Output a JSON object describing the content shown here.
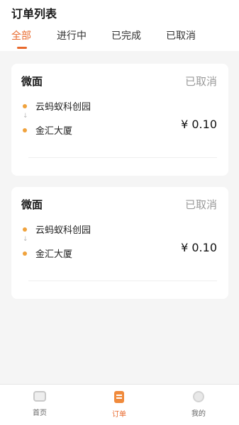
{
  "header": {
    "title": "订单列表"
  },
  "tabs": [
    {
      "label": "全部",
      "active": true
    },
    {
      "label": "进行中",
      "active": false
    },
    {
      "label": "已完成",
      "active": false
    },
    {
      "label": "已取消",
      "active": false
    }
  ],
  "orders": [
    {
      "shop": "微面",
      "status": "已取消",
      "from": "云蚂蚁科创园",
      "to": "金汇大厦",
      "price": "¥ 0.10"
    },
    {
      "shop": "微面",
      "status": "已取消",
      "from": "云蚂蚁科创园",
      "to": "金汇大厦",
      "price": "¥ 0.10"
    }
  ],
  "tabbar": [
    {
      "label": "首页",
      "icon": "home-icon",
      "active": false
    },
    {
      "label": "订单",
      "icon": "order-icon",
      "active": true
    },
    {
      "label": "我的",
      "icon": "profile-icon",
      "active": false
    }
  ],
  "colors": {
    "accent": "#e8692c",
    "dot": "#f0a23c",
    "status": "#9a9a9a"
  }
}
